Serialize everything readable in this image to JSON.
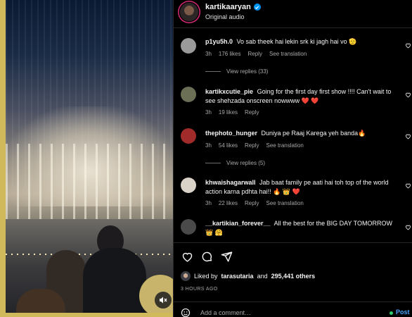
{
  "post": {
    "username": "kartikaaryan",
    "subtitle": "Original audio"
  },
  "comments": [
    {
      "username": "p1yu5h.0",
      "text": "Vo sab theek hai lekin srk ki jagh hai vo 🫡",
      "time": "3h",
      "likes": "176 likes",
      "reply": "Reply",
      "translate": "See translation",
      "view_replies": "View replies (33)"
    },
    {
      "username": "kartikxcutie_pie",
      "text": "Going for the first day first show !!!! Can't wait to see shehzada onscreen nowwww ❤️ ❤️",
      "time": "3h",
      "likes": "19 likes",
      "reply": "Reply"
    },
    {
      "username": "thephoto_hunger",
      "text": "Duniya pe Raaj Karega yeh banda🔥",
      "time": "3h",
      "likes": "54 likes",
      "reply": "Reply",
      "translate": "See translation",
      "view_replies": "View replies (5)"
    },
    {
      "username": "khwaishagarwall",
      "text": "Jab baat family pe aati hai toh top of the world action karna pdhta hai!! 🔥 👑 ❤️",
      "time": "3h",
      "likes": "22 likes",
      "reply": "Reply",
      "translate": "See translation"
    },
    {
      "username": "__kartikian_forever__",
      "text": "All the best for the BIG DAY TOMORROW 👑 🤗"
    }
  ],
  "likes_row": {
    "prefix": "Liked by",
    "user": "tarasutaria",
    "middle": "and",
    "count": "295,441 others"
  },
  "timestamp": "3 HOURS AGO",
  "add_comment": {
    "placeholder": "Add a comment…",
    "post_label": "Post"
  },
  "icons": {
    "like": "heart-icon",
    "comment": "comment-icon",
    "share": "share-icon",
    "mute": "mute-icon",
    "emoji": "emoji-icon",
    "verified": "verified-badge-icon"
  },
  "colors": {
    "background": "#000000",
    "text": "#f5f5f5",
    "muted": "#a8a8a8",
    "accent": "#0095f6",
    "post_link": "#4aa3ff"
  }
}
